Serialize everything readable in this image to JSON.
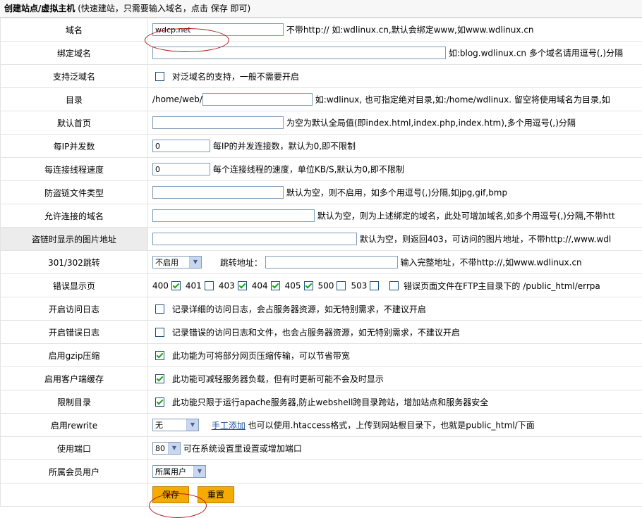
{
  "header": {
    "title": "创建站点/虚拟主机",
    "subtitle": "(快速建站，只需要输入域名，点击 保存 即可)"
  },
  "rows": {
    "domain": {
      "label": "域名",
      "value": "wdcp.net",
      "hint": "不带http:// 如:wdlinux.cn,默认会绑定www,如www.wdlinux.cn"
    },
    "bind": {
      "label": "绑定域名",
      "value": "",
      "hint": "如:blog.wdlinux.cn 多个域名请用逗号(,)分隔"
    },
    "wildcard": {
      "label": "支持泛域名",
      "text": "对泛域名的支持，一般不需要开启"
    },
    "dir": {
      "label": "目录",
      "prefix": "/home/web/",
      "value": "",
      "hint": "如:wdlinux, 也可指定绝对目录,如:/home/wdlinux. 留空将使用域名为目录,如"
    },
    "index": {
      "label": "默认首页",
      "value": "",
      "hint": "为空为默认全局值(即index.html,index.php,index.htm),多个用逗号(,)分隔"
    },
    "conn": {
      "label": "每IP并发数",
      "value": "0",
      "hint": "每IP的并发连接数，默认为0,即不限制"
    },
    "speed": {
      "label": "每连接线程速度",
      "value": "0",
      "hint": "每个连接线程的速度，单位KB/S,默认为0,即不限制"
    },
    "leech_types": {
      "label": "防盗链文件类型",
      "value": "",
      "hint": "默认为空，则不启用，如多个用逗号(,)分隔,如jpg,gif,bmp"
    },
    "allow_domains": {
      "label": "允许连接的域名",
      "value": "",
      "hint": "默认为空，则为上述绑定的域名，此处可增加域名,如多个用逗号(,)分隔,不带htt"
    },
    "leech_image": {
      "label": "盗链时显示的图片地址",
      "value": "",
      "hint": "默认为空，则返回403，可访问的图片地址，不带http://,www.wdl"
    },
    "redirect": {
      "label": "301/302跳转",
      "select": "不启用",
      "addr_label": "跳转地址：",
      "value": "",
      "hint": "输入完整地址，不带http://,如www.wdlinux.cn"
    },
    "errors": {
      "label": "错误显示页",
      "codes": [
        {
          "code": "400",
          "checked": true
        },
        {
          "code": "401",
          "checked": false
        },
        {
          "code": "403",
          "checked": true
        },
        {
          "code": "404",
          "checked": true
        },
        {
          "code": "405",
          "checked": true
        },
        {
          "code": "500",
          "checked": false
        },
        {
          "code": "503",
          "checked": false
        }
      ],
      "hint": "错误页面文件在FTP主目录下的 /public_html/errpa"
    },
    "access_log": {
      "label": "开启访问日志",
      "text": "记录详细的访问日志，会占服务器资源，如无特别需求，不建议开启"
    },
    "error_log": {
      "label": "开启错误日志",
      "text": "记录错误的访问日志和文件，也会占服务器资源，如无特别需求，不建议开启"
    },
    "gzip": {
      "label": "启用gzip压缩",
      "text": "此功能为可将部分网页压缩传输，可以节省带宽"
    },
    "cache": {
      "label": "启用客户端缓存",
      "text": "此功能可减轻服务器负载，但有时更新可能不会及时显示"
    },
    "restrict": {
      "label": "限制目录",
      "text": "此功能只限于运行apache服务器,防止webshell跨目录跨站，增加站点和服务器安全"
    },
    "rewrite": {
      "label": "启用rewrite",
      "select": "无",
      "link": "手工添加",
      "hint": "也可以使用.htaccess格式，上传到网站根目录下，也就是public_html/下面"
    },
    "port": {
      "label": "使用端口",
      "select": "80",
      "hint": "可在系统设置里设置或增加端口"
    },
    "member": {
      "label": "所属会员用户",
      "select": "所属用户"
    }
  },
  "actions": {
    "save": "保存",
    "reset": "重置"
  },
  "colors": {
    "accent_button": "#f6ab00",
    "check": "#21a121",
    "highlight_ellipse": "#b01818",
    "link": "#1a4f9b"
  },
  "icons": {
    "checkbox": "checkbox-icon",
    "dropdown": "dropdown-arrow-icon"
  }
}
